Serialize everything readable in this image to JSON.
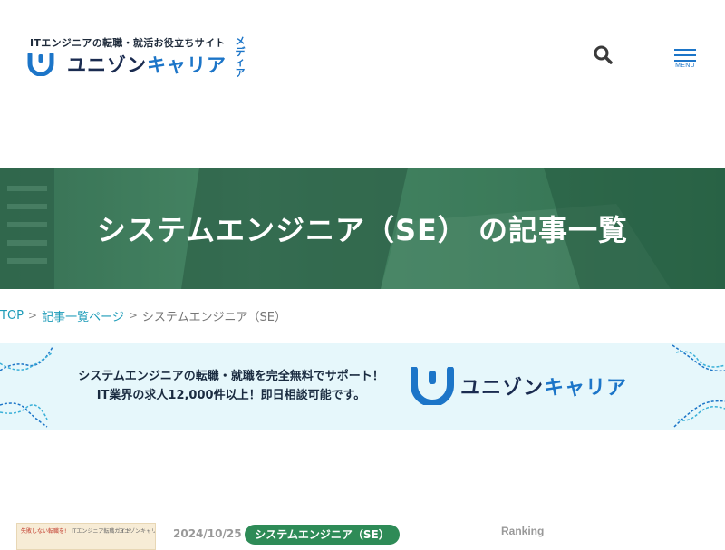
{
  "header": {
    "tagline": "ITエンジニアの転職・就活お役立ちサイト",
    "brand_main": "ユニゾン",
    "brand_accent": "キャリア",
    "media_label": "メディア",
    "search_icon": "search-icon",
    "menu_label": "MENU"
  },
  "hero": {
    "title": "システムエンジニア（SE） の記事一覧"
  },
  "breadcrumb": {
    "items": [
      "TOP",
      "記事一覧ページ"
    ],
    "separator": ">",
    "current": "システムエンジニア（SE）"
  },
  "banner": {
    "line1": "システムエンジニアの転職・就職を完全無料でサポート！",
    "line2": "IT業界の求人12,000件以上！即日相談可能です。",
    "brand_main": "ユニゾン",
    "brand_accent": "キャリア"
  },
  "article": {
    "thumb_text_left": "失敗しない転職を!",
    "thumb_text_mid": "ITエンジニア転職ガイド",
    "thumb_text_right": "ユニゾンキャリア",
    "date": "2024/10/25",
    "category": "システムエンジニア（SE）"
  },
  "sidebar": {
    "ranking_label": "Ranking"
  },
  "colors": {
    "brand_blue": "#1c75c8",
    "hero_green": "#2e7d52",
    "tag_green": "#2e8b57",
    "link_teal": "#1c9bb8",
    "banner_bg": "#e6f7fb"
  }
}
